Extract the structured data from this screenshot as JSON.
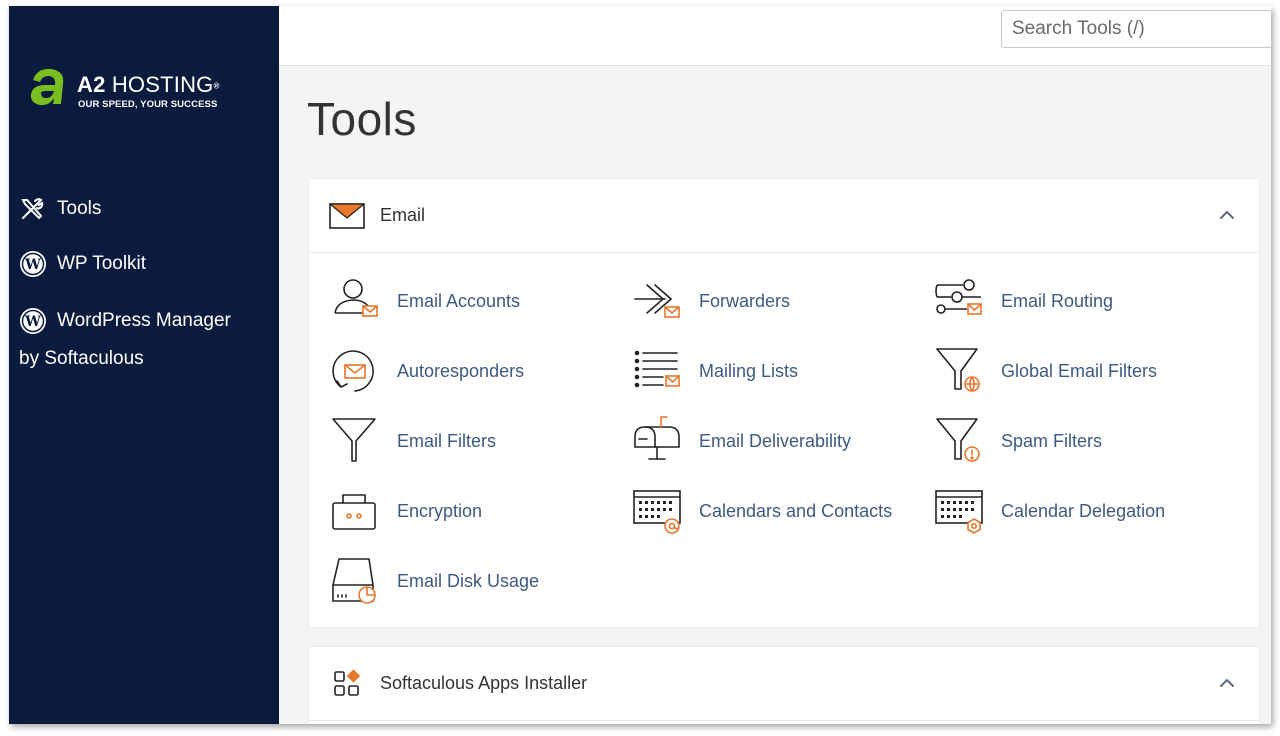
{
  "brand": {
    "name_bold": "A2",
    "name_thin": "HOSTING",
    "trademark": "®",
    "tagline": "OUR SPEED, YOUR SUCCESS"
  },
  "sidebar": {
    "items": [
      {
        "label": "Tools",
        "icon": "tools-icon"
      },
      {
        "label": "WP Toolkit",
        "icon": "wordpress-icon"
      },
      {
        "label_line1": "WordPress Manager",
        "label_line2": "by Softaculous",
        "icon": "wordpress-icon"
      }
    ]
  },
  "search": {
    "placeholder": "Search Tools (/)",
    "value": ""
  },
  "page": {
    "title": "Tools"
  },
  "panels": [
    {
      "title": "Email",
      "icon": "envelope-icon",
      "expanded": true,
      "tools": [
        {
          "label": "Email Accounts",
          "icon": "email-accounts-icon"
        },
        {
          "label": "Forwarders",
          "icon": "forwarders-icon"
        },
        {
          "label": "Email Routing",
          "icon": "email-routing-icon"
        },
        {
          "label": "Autoresponders",
          "icon": "autoresponders-icon"
        },
        {
          "label": "Mailing Lists",
          "icon": "mailing-lists-icon"
        },
        {
          "label": "Global Email Filters",
          "icon": "global-filter-icon"
        },
        {
          "label": "Email Filters",
          "icon": "filter-icon"
        },
        {
          "label": "Email Deliverability",
          "icon": "mailbox-icon"
        },
        {
          "label": "Spam Filters",
          "icon": "spam-filter-icon"
        },
        {
          "label": "Encryption",
          "icon": "encryption-icon"
        },
        {
          "label": "Calendars and Contacts",
          "icon": "calendar-contacts-icon"
        },
        {
          "label": "Calendar Delegation",
          "icon": "calendar-delegation-icon"
        },
        {
          "label": "Email Disk Usage",
          "icon": "disk-usage-icon"
        }
      ]
    },
    {
      "title": "Softaculous Apps Installer",
      "icon": "apps-grid-icon",
      "expanded": true
    }
  ],
  "colors": {
    "sidebar_bg": "#0a1b3d",
    "accent_orange": "#e8762b",
    "brand_green": "#78be20",
    "link_blue": "#3d5a80"
  }
}
